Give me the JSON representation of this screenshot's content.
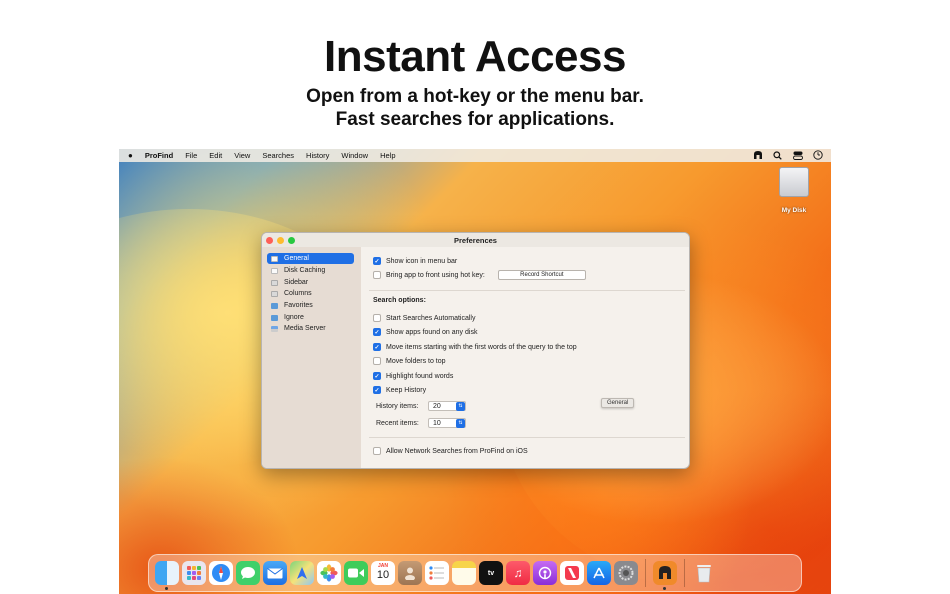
{
  "headline": {
    "title": "Instant Access",
    "line1": "Open from a hot-key or the menu bar.",
    "line2": "Fast searches for applications."
  },
  "menubar": {
    "apple": "",
    "app_name": "ProFind",
    "items": [
      "File",
      "Edit",
      "View",
      "Searches",
      "History",
      "Window",
      "Help"
    ],
    "status_icons": [
      "profind-status-icon",
      "spotlight-search-icon",
      "control-center-icon",
      "clock-icon"
    ]
  },
  "desktop": {
    "disk_label": "My Disk"
  },
  "preferences": {
    "title": "Preferences",
    "sidebar": [
      {
        "label": "General",
        "icon": "general-icon",
        "selected": true
      },
      {
        "label": "Disk Caching",
        "icon": "disk-caching-icon"
      },
      {
        "label": "Sidebar",
        "icon": "sidebar-icon"
      },
      {
        "label": "Columns",
        "icon": "columns-icon"
      },
      {
        "label": "Favorites",
        "icon": "favorites-folder-icon"
      },
      {
        "label": "Ignore",
        "icon": "ignore-folder-icon"
      },
      {
        "label": "Media Server",
        "icon": "media-server-icon"
      }
    ],
    "show_icon": {
      "label": "Show icon in menu bar",
      "checked": true
    },
    "bring_front": {
      "label": "Bring app to front using hot key:",
      "checked": false
    },
    "record_shortcut": "Record Shortcut",
    "search_options_label": "Search options:",
    "options": [
      {
        "label": "Start Searches Automatically",
        "checked": false
      },
      {
        "label": "Show apps found on any disk",
        "checked": true
      },
      {
        "label": "Move items starting with the first words of the query to the top",
        "checked": true
      },
      {
        "label": "Move folders to top",
        "checked": false
      },
      {
        "label": "Highlight found words",
        "checked": true
      },
      {
        "label": "Keep History",
        "checked": true
      }
    ],
    "history_items": {
      "label": "History items:",
      "value": "20"
    },
    "recent_items": {
      "label": "Recent items:",
      "value": "10"
    },
    "tooltip": "General",
    "network": {
      "label": "Allow Network Searches from ProFind on iOS",
      "checked": false
    }
  },
  "dock": {
    "calendar_month": "JAN",
    "calendar_day": "10",
    "tv_label": "tv",
    "apps": [
      "finder",
      "launchpad",
      "safari",
      "messages",
      "mail",
      "maps",
      "photos",
      "facetime",
      "calendar",
      "contacts",
      "reminders",
      "notes",
      "apple-tv",
      "music",
      "podcasts",
      "news",
      "app-store",
      "system-settings",
      "profind",
      "trash"
    ]
  },
  "colors": {
    "accent": "#1f6fe5",
    "window_bg": "#f5f1ec",
    "sidebar_bg": "#e6dcd3"
  }
}
